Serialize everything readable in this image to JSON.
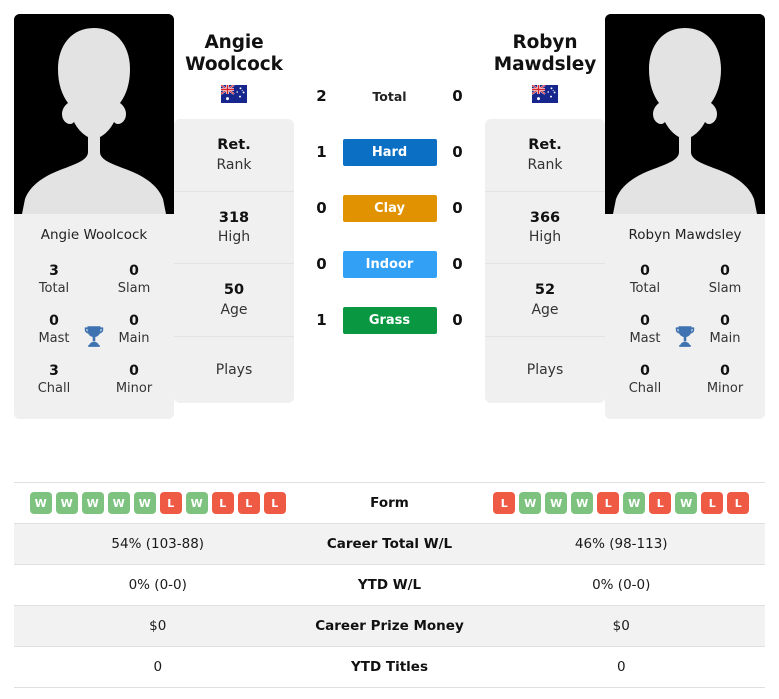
{
  "colors": {
    "hard": "#0b6fc4",
    "clay": "#e09200",
    "indoor": "#32a1f5",
    "grass": "#099741",
    "win_badge": "#7dc37f",
    "loss_badge": "#ef5a45",
    "trophy": "#3f72b0",
    "card_bg": "#f0f0f0",
    "row_shade": "#f2f2f2"
  },
  "players": {
    "left": {
      "first_name": "Angie",
      "last_name": "Woolcock",
      "full_name": "Angie Woolcock",
      "country_flag": "australia-flag",
      "photo": "player-silhouette",
      "titles": [
        {
          "value": "3",
          "label": "Total"
        },
        {
          "value": "0",
          "label": "Slam"
        },
        {
          "value": "0",
          "label": "Mast"
        },
        {
          "value": "0",
          "label": "Main"
        },
        {
          "value": "3",
          "label": "Chall"
        },
        {
          "value": "0",
          "label": "Minor"
        }
      ],
      "stats": [
        {
          "value": "Ret.",
          "label": "Rank"
        },
        {
          "value": "318",
          "label": "High"
        },
        {
          "value": "50",
          "label": "Age"
        },
        {
          "value": "",
          "label": "Plays"
        }
      ],
      "form": [
        "W",
        "W",
        "W",
        "W",
        "W",
        "L",
        "W",
        "L",
        "L",
        "L"
      ],
      "career_total_wl": "54% (103-88)",
      "ytd_wl": "0% (0-0)",
      "career_prize_money": "$0",
      "ytd_titles": "0"
    },
    "right": {
      "first_name": "Robyn",
      "last_name": "Mawdsley",
      "full_name": "Robyn Mawdsley",
      "country_flag": "australia-flag",
      "photo": "player-silhouette",
      "titles": [
        {
          "value": "0",
          "label": "Total"
        },
        {
          "value": "0",
          "label": "Slam"
        },
        {
          "value": "0",
          "label": "Mast"
        },
        {
          "value": "0",
          "label": "Main"
        },
        {
          "value": "0",
          "label": "Chall"
        },
        {
          "value": "0",
          "label": "Minor"
        }
      ],
      "stats": [
        {
          "value": "Ret.",
          "label": "Rank"
        },
        {
          "value": "366",
          "label": "High"
        },
        {
          "value": "52",
          "label": "Age"
        },
        {
          "value": "",
          "label": "Plays"
        }
      ],
      "form": [
        "L",
        "W",
        "W",
        "W",
        "L",
        "W",
        "L",
        "W",
        "L",
        "L"
      ],
      "career_total_wl": "46% (98-113)",
      "ytd_wl": "0% (0-0)",
      "career_prize_money": "$0",
      "ytd_titles": "0"
    }
  },
  "head_to_head": [
    {
      "label": "Total",
      "left": "2",
      "right": "0",
      "style": "plain",
      "color": ""
    },
    {
      "label": "Hard",
      "left": "1",
      "right": "0",
      "style": "filled",
      "color": "#0b6fc4"
    },
    {
      "label": "Clay",
      "left": "0",
      "right": "0",
      "style": "filled",
      "color": "#e09200"
    },
    {
      "label": "Indoor",
      "left": "0",
      "right": "0",
      "style": "filled",
      "color": "#32a1f5"
    },
    {
      "label": "Grass",
      "left": "1",
      "right": "0",
      "style": "filled",
      "color": "#099741"
    }
  ],
  "comparison_rows": [
    {
      "label": "Form",
      "key": "form",
      "type": "form"
    },
    {
      "label": "Career Total W/L",
      "key": "career_total_wl",
      "type": "text"
    },
    {
      "label": "YTD W/L",
      "key": "ytd_wl",
      "type": "text"
    },
    {
      "label": "Career Prize Money",
      "key": "career_prize_money",
      "type": "text"
    },
    {
      "label": "YTD Titles",
      "key": "ytd_titles",
      "type": "text"
    }
  ],
  "icons": {
    "trophy": "trophy-icon"
  }
}
